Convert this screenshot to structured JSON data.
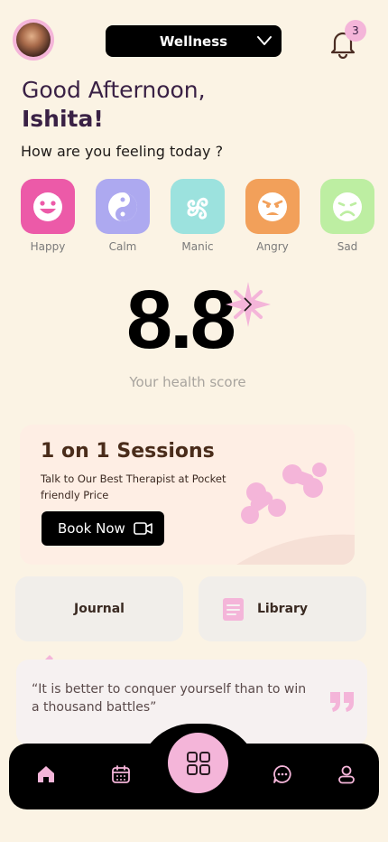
{
  "header": {
    "category": "Wellness",
    "notification_count": "3"
  },
  "greeting": {
    "line1": "Good Afternoon,",
    "name": "Ishita!",
    "prompt": "How are you feeling today ?"
  },
  "moods": [
    {
      "label": "Happy",
      "color": "#EC5AA8",
      "icon": "smile-icon"
    },
    {
      "label": "Calm",
      "color": "#ADA9F0",
      "icon": "yin-yang-icon"
    },
    {
      "label": "Manic",
      "color": "#9CE2DE",
      "icon": "triskelion-icon"
    },
    {
      "label": "Angry",
      "color": "#F2A05A",
      "icon": "angry-face-icon"
    },
    {
      "label": "Sad",
      "color": "#BDEEA2",
      "icon": "sad-face-icon"
    }
  ],
  "health": {
    "score": "8.8",
    "label": "Your health score"
  },
  "session": {
    "title": "1 on 1 Sessions",
    "description": "Talk to Our Best Therapist at Pocket friendly Price",
    "button_label": "Book Now"
  },
  "tiles": {
    "journal": "Journal",
    "library": "Library"
  },
  "quote": {
    "text": "“It is better to conquer yourself than to win a thousand battles”"
  },
  "nav": {
    "items": [
      "home-icon",
      "calendar-icon",
      "grid-icon",
      "chat-icon",
      "profile-icon"
    ]
  },
  "colors": {
    "background": "#FBF3E4",
    "accent_pink": "#F4B5D9",
    "text_purple": "#3A2145"
  }
}
